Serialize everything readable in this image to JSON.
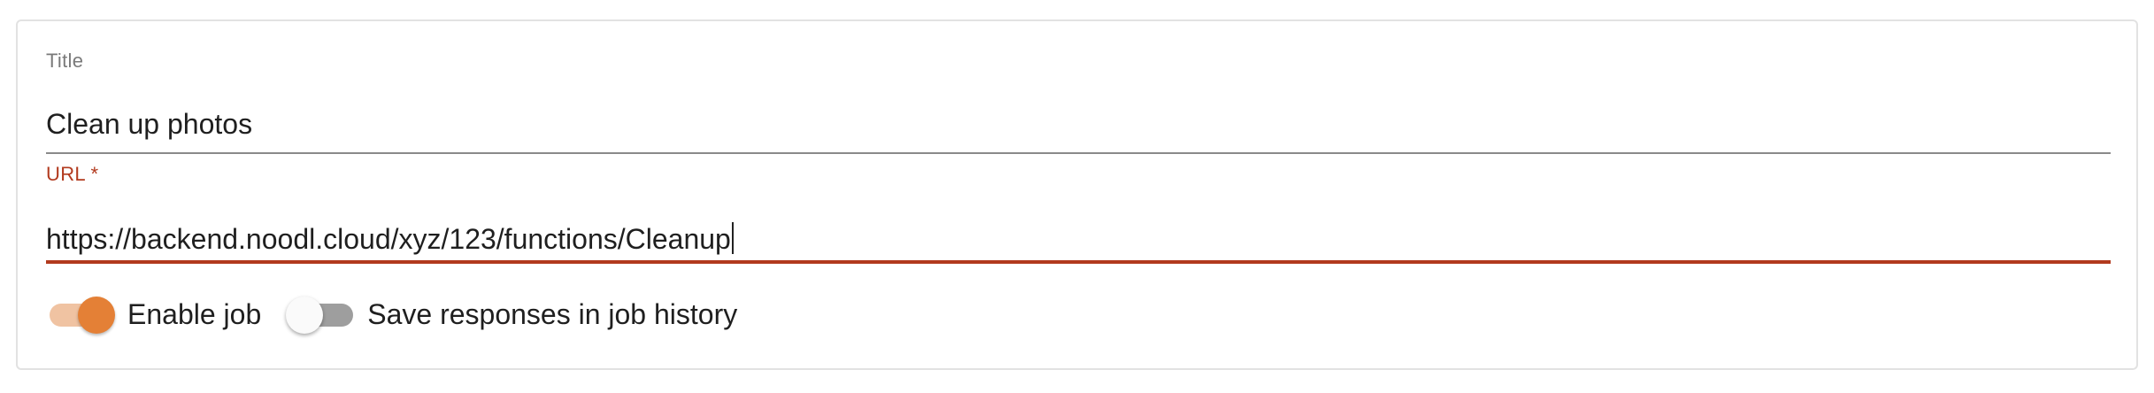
{
  "form": {
    "title_field": {
      "label": "Title",
      "value": "Clean up photos"
    },
    "url_field": {
      "label": "URL *",
      "value": "https://backend.noodl.cloud/xyz/123/functions/Cleanup",
      "state": "error"
    },
    "toggles": [
      {
        "label": "Enable job",
        "checked": true
      },
      {
        "label": "Save responses in job history",
        "checked": false
      }
    ]
  },
  "colors": {
    "accent": "#e48036",
    "accent_track": "#f0c3a2",
    "error": "#b23a1e",
    "toggle_off_track": "#9e9e9e",
    "border": "#e2e2e2"
  }
}
